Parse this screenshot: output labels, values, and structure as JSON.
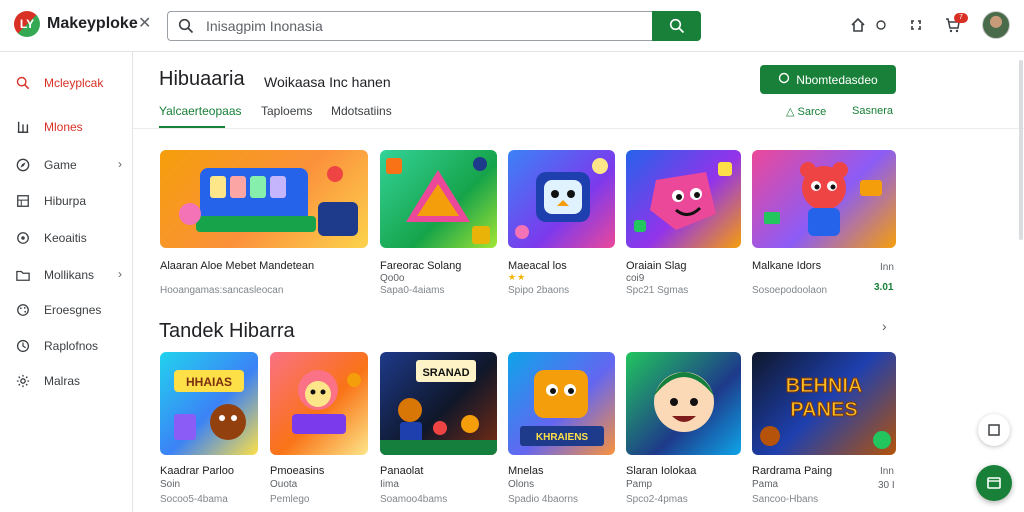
{
  "app": {
    "brand": "Makeyploke",
    "logo_text": "LY",
    "accent_color": "#188038",
    "active_color": "#d93025"
  },
  "search": {
    "value": "Inisagpim Inonasia"
  },
  "top_icons": [
    "home-icon",
    "status-dot-icon",
    "gamepad-icon",
    "cart-icon",
    "avatar"
  ],
  "notification_count": "7",
  "sidebar": {
    "items": [
      {
        "label": "Mcleyplcak",
        "icon": "search-icon",
        "active": true
      },
      {
        "label": "Mlones",
        "icon": "library-icon",
        "active": true
      },
      {
        "label": "Game",
        "icon": "compass-icon",
        "chevron": true
      },
      {
        "label": "Hiburpa",
        "icon": "grid-icon"
      },
      {
        "label": "Keoaitis",
        "icon": "puzzle-icon"
      },
      {
        "label": "Mollikans",
        "icon": "folder-icon",
        "chevron": true
      },
      {
        "label": "Eroesgnes",
        "icon": "palette-icon"
      },
      {
        "label": "Raplofnos",
        "icon": "clock-icon"
      },
      {
        "label": "Malras",
        "icon": "settings-icon"
      }
    ]
  },
  "header": {
    "title": "Hibuaaria",
    "subtitle": "Woikaasa Inc hanen",
    "primary_button": "Nbomtedasdeo"
  },
  "tabs": [
    {
      "label": "Yalcaerteopaas",
      "active": true
    },
    {
      "label": "Taploems"
    },
    {
      "label": "Mdotsatiins"
    }
  ],
  "links": {
    "left": "Sarce",
    "right": "Sasnera"
  },
  "row1": [
    {
      "title": "Alaaran Aloe Mebet Mandetean",
      "sub": "",
      "meta": "Hooangamas:sancasleocan",
      "right_top": "",
      "right_bottom": ""
    },
    {
      "title": "Fareorac Solang",
      "sub": "Qo0o",
      "meta": "Sapa0-4aiams",
      "right_top": "",
      "right_bottom": ""
    },
    {
      "title": "Maeacal los",
      "sub": "",
      "stars": "★★",
      "meta": "Spipo 2baons",
      "right_top": "",
      "right_bottom": ""
    },
    {
      "title": "Oraiain Slag",
      "sub": "coi9",
      "meta": "Spc21 Sgmas",
      "right_top": "",
      "right_bottom": ""
    },
    {
      "title": "Malkane Idors",
      "sub": "",
      "meta": "Sosoepodoolaon",
      "right_top": "Inn",
      "right_bottom": "3.01"
    }
  ],
  "section": {
    "title": "Tandek Hibarra"
  },
  "row2": [
    {
      "title": "Kaadrar Parloo",
      "sub": "Soin",
      "meta": "Socoo5-4bama",
      "right_top": "",
      "right_bottom": ""
    },
    {
      "title": "Pmoeasins",
      "sub": "Ouota",
      "meta": "Pemlego",
      "right_top": "",
      "right_bottom": ""
    },
    {
      "title": "Panaolat",
      "sub": "Iima",
      "meta": "Soamoo4bams",
      "right_top": "",
      "right_bottom": ""
    },
    {
      "title": "Mnelas",
      "sub": "Olons",
      "meta": "Spadio 4baorns",
      "right_top": "",
      "right_bottom": ""
    },
    {
      "title": "Slaran Iolokaa",
      "sub": "Pamp",
      "meta": "Spco2-4pmas",
      "right_top": "",
      "right_bottom": ""
    },
    {
      "title": "Rardrama Paing",
      "sub": "Pama",
      "meta": "Sancoo-Hbans",
      "right_top": "Inn",
      "right_bottom": "30 I"
    }
  ],
  "art_text": {
    "banner1": "HHAIAS",
    "banner2a": "SRANAD",
    "banner3": "KHRAIENS",
    "banner4a": "BEHNIA",
    "banner4b": "PANES"
  }
}
